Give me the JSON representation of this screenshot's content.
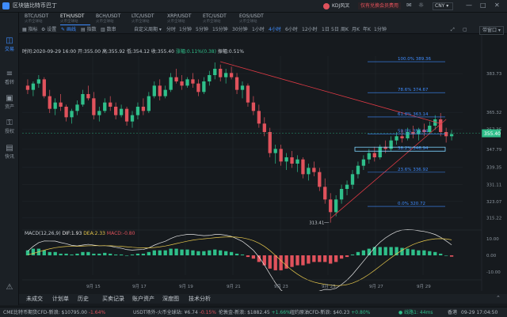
{
  "window": {
    "title": "区块链比特币巴丁",
    "user": "KDJ风叉",
    "upgrade_badge": "仅有兑换会员费用",
    "currency": "CNY"
  },
  "sidebar": {
    "items": [
      {
        "label": "交易",
        "icon": "chart-icon"
      },
      {
        "label": "看转",
        "icon": "list-icon"
      },
      {
        "label": "资产",
        "icon": "wallet-icon"
      },
      {
        "label": "授权",
        "icon": "key-icon"
      },
      {
        "label": "快讯",
        "icon": "news-icon"
      }
    ]
  },
  "pairs": [
    {
      "name": "BTC/USDT",
      "sub": "火币全球站"
    },
    {
      "name": "ETH/USDT",
      "sub": "火币全球站"
    },
    {
      "name": "BCH/USDT",
      "sub": "火币全球站"
    },
    {
      "name": "LTC/USDT",
      "sub": "火币全球站"
    },
    {
      "name": "XRP/USDT",
      "sub": "火币全球站"
    },
    {
      "name": "ETC/USDT",
      "sub": "火币全球站"
    },
    {
      "name": "EOS/USDT",
      "sub": "火币全球站"
    }
  ],
  "toolbar": {
    "tools": [
      "指标",
      "设置",
      "画线",
      "指数",
      "数串"
    ],
    "custom_period": "自定义周期",
    "periods": [
      "分时",
      "1分钟",
      "5分钟",
      "15分钟",
      "30分钟",
      "1小时",
      "4小时",
      "6小时",
      "12小时",
      "1日",
      "5日",
      "周K",
      "月K",
      "年K",
      "1分钟"
    ],
    "active_period": "4小时",
    "layout_btn": "带窗口"
  },
  "chart_info": {
    "time": "时间:2020-09-29 16:00",
    "open": "开:355.00",
    "high": "高:355.92",
    "low": "低:354.12",
    "close": "收:355.40",
    "change": "涨幅:0.11%(0.38)",
    "amplitude": "振幅:0.51%"
  },
  "fib_levels": [
    {
      "label": "100.0% 389.36",
      "price": 389.36
    },
    {
      "label": "78.6% 374.67",
      "price": 374.67
    },
    {
      "label": "61.8% 363.14",
      "price": 363.14
    },
    {
      "label": "50.0% 355.04",
      "price": 355.04
    },
    {
      "label": "38.2% 346.94",
      "price": 346.94
    },
    {
      "label": "23.6% 336.92",
      "price": 336.92
    },
    {
      "label": "0.0% 320.72",
      "price": 320.72
    }
  ],
  "price_axis": [
    "383.73",
    "365.32",
    "357.35",
    "347.79",
    "339.35",
    "331.11",
    "323.07",
    "315.22"
  ],
  "price_axis_values": [
    383.73,
    365.32,
    357.35,
    347.79,
    339.35,
    331.11,
    323.07,
    315.22
  ],
  "current_price": "355.40",
  "low_marker": "313.41",
  "date_axis": [
    "9月 15",
    "9月 17",
    "9月 19",
    "9月 21",
    "9月 23",
    "9月 25",
    "9月 27",
    "9月 29"
  ],
  "macd": {
    "label": "MACD(12,26,9)",
    "dif": "DIF:1.93",
    "dea": "DEA:2.33",
    "macd": "MACD:-0.80",
    "axis": [
      "10.00",
      "0.00",
      "-10.00"
    ],
    "dif_color": "#e8e8e8",
    "dea_color": "#e8c94c"
  },
  "bottom_tabs": [
    "未成交",
    "计划单",
    "历史",
    "买卖记录",
    "账户资产",
    "深度图",
    "技术分析"
  ],
  "ticker": [
    {
      "text": "CME比特币期货CFD-新浪: $10795.00",
      "change": "-1.64%",
      "color": "#e0525c"
    },
    {
      "text": "USDT场外-火币全球站: ¥6.74",
      "change": "-0.15%",
      "color": "#e0525c"
    },
    {
      "text": "伦敦金-新浪: $1882.45",
      "change": "+1.66%",
      "color": "#2fbf8a"
    },
    {
      "text": "纽约原油CFD-新浪: $40.23",
      "change": "+0.80%",
      "color": "#2fbf8a"
    }
  ],
  "status": {
    "latency": "线路1: 44ms",
    "region": "香港",
    "clock": "09-29 17:04:50"
  },
  "colors": {
    "up": "#2fbf8a",
    "down": "#e0525c",
    "accent": "#3e8cff",
    "fib": "#3e8cff",
    "trendline": "#e03a45"
  },
  "chart_data": {
    "type": "candlestick",
    "ylim": [
      311,
      392
    ],
    "x": [
      "9月 15",
      "9月 17",
      "9月 19",
      "9月 21",
      "9月 23",
      "9月 25",
      "9月 27",
      "9月 29"
    ],
    "candles": [
      [
        378,
        381,
        374,
        376
      ],
      [
        376,
        380,
        373,
        379
      ],
      [
        379,
        383,
        377,
        381
      ],
      [
        381,
        382,
        372,
        373
      ],
      [
        373,
        376,
        365,
        367
      ],
      [
        367,
        372,
        364,
        370
      ],
      [
        370,
        374,
        366,
        368
      ],
      [
        368,
        369,
        361,
        363
      ],
      [
        363,
        367,
        360,
        366
      ],
      [
        366,
        371,
        364,
        369
      ],
      [
        369,
        376,
        368,
        374
      ],
      [
        374,
        378,
        371,
        372
      ],
      [
        372,
        375,
        362,
        364
      ],
      [
        364,
        368,
        361,
        366
      ],
      [
        366,
        372,
        365,
        370
      ],
      [
        370,
        373,
        366,
        368
      ],
      [
        368,
        370,
        362,
        364
      ],
      [
        364,
        369,
        363,
        367
      ],
      [
        367,
        368,
        359,
        361
      ],
      [
        361,
        366,
        358,
        364
      ],
      [
        364,
        370,
        362,
        368
      ],
      [
        368,
        372,
        364,
        366
      ],
      [
        366,
        375,
        365,
        373
      ],
      [
        373,
        380,
        372,
        378
      ],
      [
        378,
        381,
        371,
        373
      ],
      [
        373,
        378,
        372,
        376
      ],
      [
        376,
        384,
        375,
        382
      ],
      [
        382,
        386,
        379,
        380
      ],
      [
        380,
        383,
        376,
        378
      ],
      [
        378,
        382,
        377,
        381
      ],
      [
        381,
        384,
        377,
        379
      ],
      [
        379,
        381,
        373,
        375
      ],
      [
        375,
        382,
        374,
        380
      ],
      [
        380,
        385,
        378,
        383
      ],
      [
        383,
        389,
        381,
        386
      ],
      [
        386,
        388,
        380,
        382
      ],
      [
        382,
        386,
        379,
        384
      ],
      [
        384,
        387,
        381,
        382
      ],
      [
        382,
        384,
        374,
        376
      ],
      [
        376,
        380,
        372,
        378
      ],
      [
        378,
        379,
        368,
        370
      ],
      [
        370,
        373,
        364,
        366
      ],
      [
        366,
        369,
        358,
        360
      ],
      [
        360,
        363,
        354,
        356
      ],
      [
        356,
        358,
        344,
        346
      ],
      [
        346,
        350,
        341,
        348
      ],
      [
        348,
        350,
        340,
        342
      ],
      [
        342,
        346,
        338,
        344
      ],
      [
        344,
        347,
        339,
        341
      ],
      [
        341,
        345,
        337,
        343
      ],
      [
        343,
        344,
        334,
        336
      ],
      [
        336,
        341,
        333,
        339
      ],
      [
        339,
        342,
        335,
        337
      ],
      [
        337,
        339,
        328,
        330
      ],
      [
        330,
        334,
        322,
        324
      ],
      [
        324,
        327,
        313,
        318
      ],
      [
        318,
        326,
        316,
        324
      ],
      [
        324,
        331,
        322,
        329
      ],
      [
        329,
        333,
        326,
        331
      ],
      [
        331,
        338,
        329,
        336
      ],
      [
        336,
        342,
        334,
        340
      ],
      [
        340,
        345,
        338,
        343
      ],
      [
        343,
        348,
        341,
        346
      ],
      [
        346,
        349,
        342,
        344
      ],
      [
        344,
        350,
        343,
        349
      ],
      [
        349,
        352,
        346,
        348
      ],
      [
        348,
        354,
        347,
        352
      ],
      [
        352,
        356,
        350,
        354
      ],
      [
        354,
        357,
        351,
        353
      ],
      [
        353,
        358,
        352,
        356
      ],
      [
        356,
        359,
        353,
        355
      ],
      [
        355,
        358,
        352,
        357
      ],
      [
        357,
        360,
        354,
        356
      ],
      [
        356,
        361,
        355,
        359
      ],
      [
        359,
        364,
        357,
        362
      ],
      [
        362,
        365,
        354,
        356
      ],
      [
        356,
        358,
        351,
        354
      ],
      [
        354,
        357,
        352,
        355
      ]
    ],
    "macd_hist": [
      3,
      4,
      4,
      3,
      2,
      2,
      1,
      1,
      0.5,
      1,
      2,
      2,
      1,
      1,
      1.5,
      1,
      0.5,
      0.5,
      0,
      0.5,
      1,
      1,
      2,
      3,
      3,
      3,
      4,
      4,
      3.5,
      3.5,
      3,
      2.5,
      2.5,
      3,
      3.5,
      3,
      2.5,
      2,
      1,
      0.5,
      -1,
      -2,
      -4,
      -6,
      -8,
      -9,
      -9,
      -8,
      -7,
      -6,
      -6,
      -5,
      -4,
      -4,
      -4,
      -5,
      -4,
      -2,
      -1,
      0.5,
      2,
      3,
      4,
      5,
      5,
      5,
      5,
      5,
      4.5,
      4,
      3.5,
      3,
      3,
      2.5,
      2,
      1,
      0,
      -0.8
    ]
  }
}
